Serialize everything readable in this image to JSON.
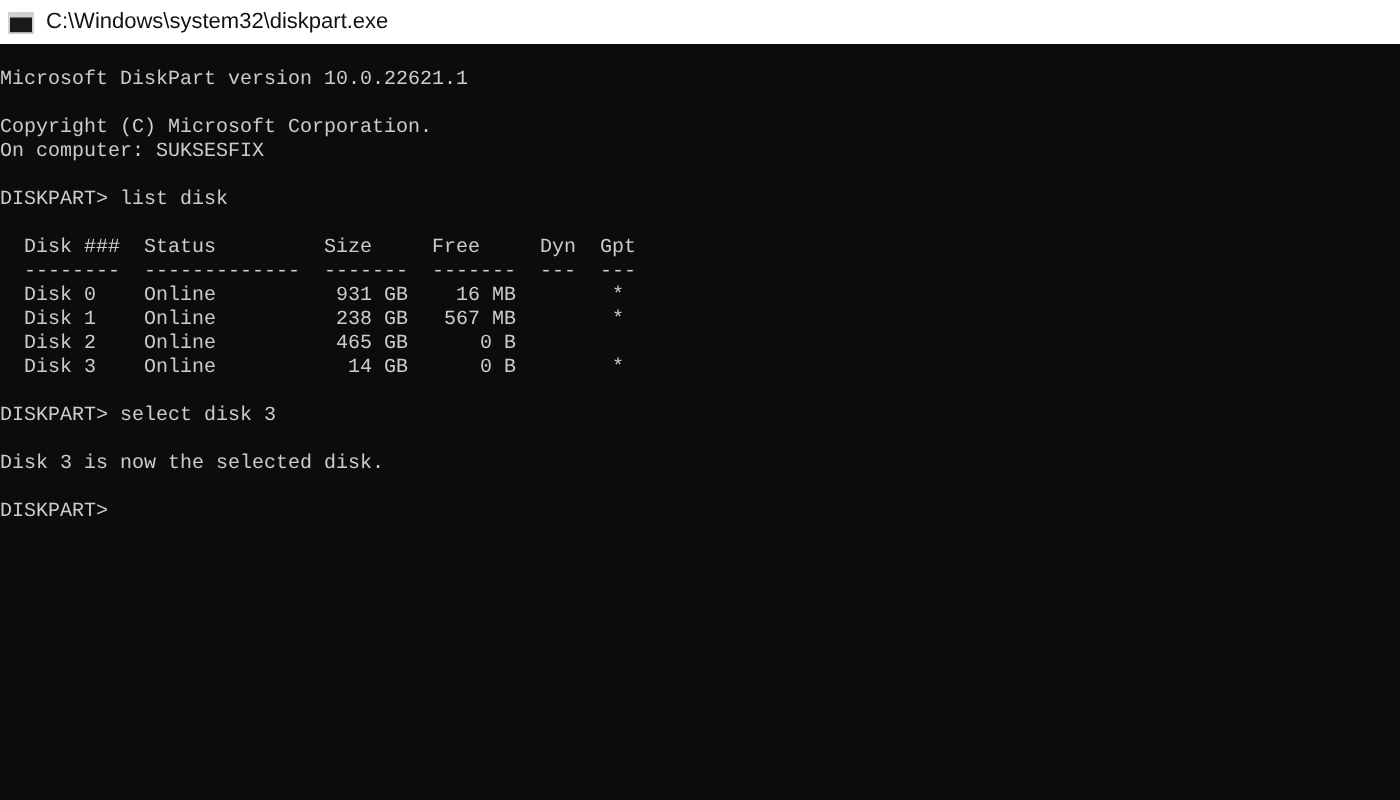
{
  "window": {
    "title": "C:\\Windows\\system32\\diskpart.exe"
  },
  "console_blocks": [
    [
      "Microsoft DiskPart version 10.0.22621.1"
    ],
    [
      "Copyright (C) Microsoft Corporation.",
      "On computer: SUKSESFIX"
    ],
    [
      "DISKPART> list disk"
    ],
    [
      "  Disk ###  Status         Size     Free     Dyn  Gpt",
      "  --------  -------------  -------  -------  ---  ---",
      "  Disk 0    Online          931 GB    16 MB        *",
      "  Disk 1    Online          238 GB   567 MB        *",
      "  Disk 2    Online          465 GB      0 B",
      "  Disk 3    Online           14 GB      0 B        *"
    ],
    [
      "DISKPART> select disk 3"
    ],
    [
      "Disk 3 is now the selected disk."
    ],
    [
      "DISKPART>"
    ]
  ]
}
